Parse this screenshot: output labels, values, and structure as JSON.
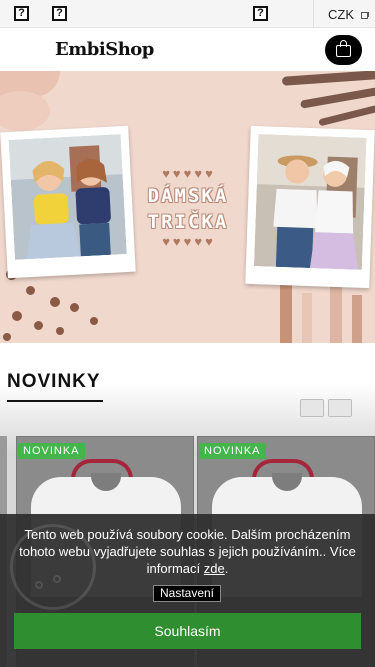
{
  "topbar": {
    "icons": [
      "help-icon",
      "help-icon",
      "help-icon"
    ],
    "currency": "CZK"
  },
  "header": {
    "logo": "EmbiShop",
    "cart_icon": "shopping-bag-icon"
  },
  "hero": {
    "title_line1": "DÁMSKÁ",
    "title_line2": "TRIČKA",
    "hearts": "♥♥♥♥♥",
    "colors": {
      "background": "#f1d8cd",
      "accent": "#b07a60"
    }
  },
  "novinky": {
    "title": "NOVINKY",
    "products": [
      {
        "badge": "NOVINKA"
      },
      {
        "badge": "NOVINKA"
      }
    ]
  },
  "cookie": {
    "text": "Tento web používá soubory cookie. Dalším procházením tohoto webu vyjadřujete souhlas s jejich používáním.. Více informací",
    "link": "zde",
    "after_link": ".",
    "settings": "Nastavení",
    "accept": "Souhlasím",
    "colors": {
      "accept": "#2f8e2f",
      "badge": "#43b54a"
    }
  }
}
